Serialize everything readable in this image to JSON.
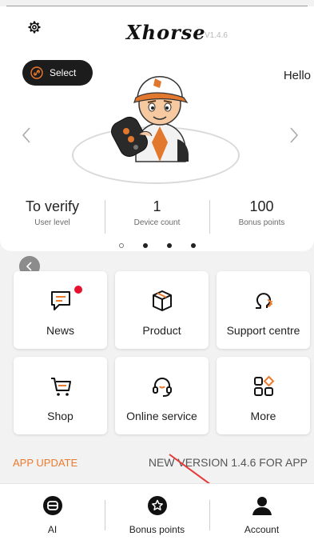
{
  "header": {
    "logo_text": "Xhorse",
    "version": "V1.4.6",
    "select_label": "Select",
    "hello": "Hello"
  },
  "stats": [
    {
      "value": "To verify",
      "label": "User level"
    },
    {
      "value": "1",
      "label": "Device count"
    },
    {
      "value": "100",
      "label": "Bonus points"
    }
  ],
  "carousel": {
    "page_count": 4,
    "active_index": 0
  },
  "grid": [
    {
      "label": "News",
      "icon": "chat-icon",
      "badge": true
    },
    {
      "label": "Product",
      "icon": "box-icon"
    },
    {
      "label": "Support centre",
      "icon": "support-icon"
    },
    {
      "label": "Shop",
      "icon": "cart-icon"
    },
    {
      "label": "Online service",
      "icon": "headset-icon"
    },
    {
      "label": "More",
      "icon": "grid-icon"
    }
  ],
  "update": {
    "label": "APP UPDATE",
    "message": "NEW VERSION 1.4.6 FOR APP"
  },
  "tabbar": [
    {
      "label": "AI",
      "icon": "ai-icon"
    },
    {
      "label": "Bonus points",
      "icon": "star-badge-icon"
    },
    {
      "label": "Account",
      "icon": "person-icon"
    }
  ],
  "colors": {
    "accent_orange": "#ec7a2d",
    "badge_red": "#e8112d",
    "annotation_red": "#e53935"
  }
}
